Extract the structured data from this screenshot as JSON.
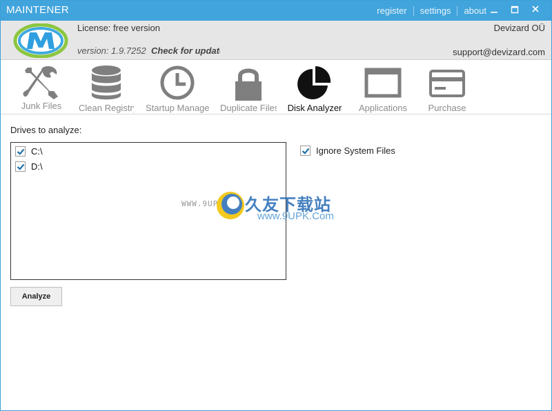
{
  "titlebar": {
    "title": "MAINTENER",
    "links": [
      "register",
      "settings",
      "about"
    ],
    "minimize_icon": "minimize-icon",
    "maximize_icon": "maximize-icon",
    "close_icon": "close-icon"
  },
  "header": {
    "license": "License: free version",
    "version": "version: 1.9.7252",
    "check_update": "Check for updates",
    "company": "Devizard OÜ",
    "support": "support@devizard.com"
  },
  "toolbar": {
    "items": [
      {
        "label": "Junk Files",
        "icon": "tools-icon"
      },
      {
        "label": "Clean Registry",
        "icon": "database-icon"
      },
      {
        "label": "Startup Manager",
        "icon": "clock-icon"
      },
      {
        "label": "Duplicate Files",
        "icon": "lock-icon"
      },
      {
        "label": "Disk Analyzer",
        "icon": "pie-chart-icon"
      },
      {
        "label": "Applications",
        "icon": "window-icon"
      },
      {
        "label": "Purchase",
        "icon": "credit-card-icon"
      }
    ],
    "active_index": 4
  },
  "content": {
    "drives_label": "Drives to analyze:",
    "drives": [
      {
        "label": "C:\\",
        "checked": true
      },
      {
        "label": "D:\\",
        "checked": true
      }
    ],
    "ignore_system_files": {
      "label": "Ignore System Files",
      "checked": true
    },
    "analyze_button": "Analyze"
  },
  "watermark": {
    "small": "WWW.9UPK.COM",
    "cn": "久友下载站",
    "url": "www.9UPK.Com"
  },
  "colors": {
    "titlebar": "#41a4dc",
    "checkmark": "#1e6fa8",
    "header_bg": "#e6e6e6"
  }
}
